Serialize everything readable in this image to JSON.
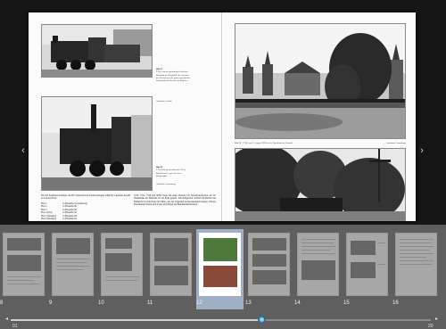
{
  "viewer": {
    "nav_prev_icon": "chevron-left-icon",
    "nav_next_icon": "chevron-right-icon",
    "nav_prev_label": "‹",
    "nav_next_label": "›"
  },
  "left_page": {
    "caption_top": {
      "title": "Bild 95",
      "text": "T 9(3) von der geräumigen einfachen Werkstatt der Dampflok, die zwischen den Dreiachsern der grünen preußischen Länderbahn bei Kesseln im Rahmen..."
    },
    "caption_top_sign": "Aufnahme: Archiv",
    "caption_mid": {
      "title": "Bild 96",
      "text": "T 9(3) 890 aus der Baureihe 91 im Betriebswerk, vorne bei einer Rangierfahrt."
    },
    "caption_mid_sign": "Aufnahme: Sammlung",
    "body_left": "Für den Zugdienst benötigte das Bw Osnabrück im Sommerfahrplan 1968 die folgenden Anzahl an Lokomotiven:",
    "list": [
      {
        "label": "Plan 1",
        "value": "1x Baureihe 91 (Güterzug)"
      },
      {
        "label": "Plan 2",
        "value": "1x Baureihe 86"
      },
      {
        "label": "Plan 3",
        "value": "1x Baureihe 86"
      },
      {
        "label": "Plan 4 (Ost)",
        "value": "1x Baureihe 93"
      },
      {
        "label": "Plan 5 (Rangier)",
        "value": "1x Baureihe 94"
      },
      {
        "label": "Plan 6 (Rangier)",
        "value": "1x Baureihe 94"
      }
    ],
    "body_right": "1970, 7552, 7558 und 9080. Dazu hat einer Nutzung der Tenderlokomotive auf der Nebenbahn der Baureihe 91 ein Ende gesetzt. Die Rangierlok verblieb im Betrieb des Bahnhofs bis zum Ende des Jahres, wie die folgenden Aufzeichnungen belegen. Weitere Einzelheiten finden sich in den Unterlagen der Bundesbahndirektion."
  },
  "right_page": {
    "caption_town": "Bild 98 · T 9(3) am 11. August 1968 bei der Durchfahrt im Ortsbild.",
    "caption_town_sign": "Aufnahme: Sammlung"
  },
  "thumbnails": {
    "selected": "12",
    "items": [
      {
        "num": "8"
      },
      {
        "num": "9"
      },
      {
        "num": "10"
      },
      {
        "num": "11"
      },
      {
        "num": "12"
      },
      {
        "num": "13"
      },
      {
        "num": "14"
      },
      {
        "num": "15"
      },
      {
        "num": "16"
      }
    ]
  },
  "slider": {
    "range_start": "01",
    "range_end": "20",
    "start_icon": "page-first-icon",
    "end_icon": "page-last-icon",
    "start_glyph": "◂",
    "end_glyph": "▸"
  },
  "colors": {
    "background": "#161616",
    "strip": "#5f5f5f",
    "selected_thumb": "#9fb0c4",
    "slider_knob": "#9ccbe8"
  }
}
